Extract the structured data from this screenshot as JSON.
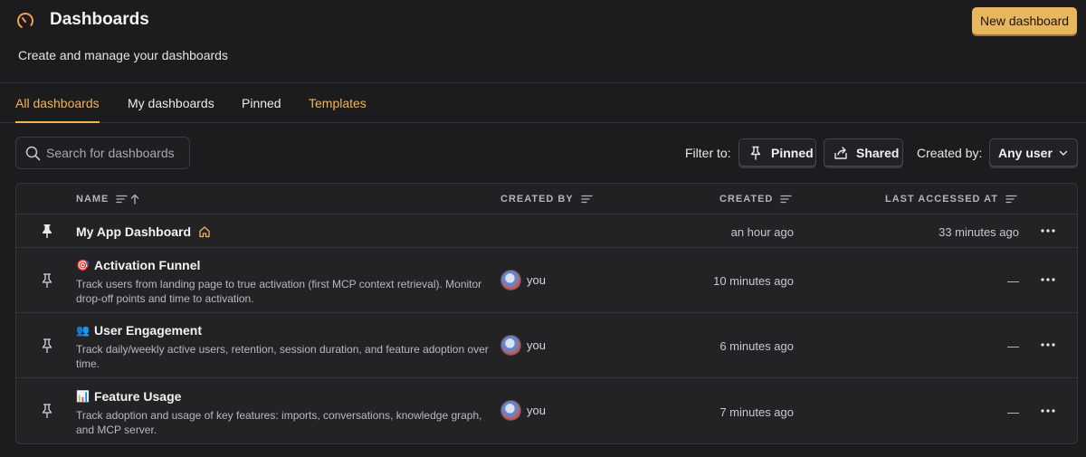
{
  "header": {
    "title": "Dashboards",
    "subtitle": "Create and manage your dashboards",
    "new_button": "New dashboard",
    "accent": "#e9b660"
  },
  "tabs": [
    {
      "label": "All dashboards",
      "active": true
    },
    {
      "label": "My dashboards",
      "active": false
    },
    {
      "label": "Pinned",
      "active": false
    },
    {
      "label": "Templates",
      "active": false
    }
  ],
  "toolbar": {
    "search_placeholder": "Search for dashboards",
    "filter_label": "Filter to:",
    "pinned_label": "Pinned",
    "shared_label": "Shared",
    "created_by_label": "Created by:",
    "created_by_value": "Any user"
  },
  "table": {
    "columns": {
      "name": "NAME",
      "created_by": "CREATED BY",
      "created": "CREATED",
      "last_accessed": "LAST ACCESSED AT"
    },
    "rows": [
      {
        "pinned": true,
        "emoji": "",
        "name": "My App Dashboard",
        "description": "",
        "creator": "",
        "created": "an hour ago",
        "last_accessed": "33 minutes ago",
        "home_icon": "home-icon"
      },
      {
        "pinned": false,
        "emoji": "🎯",
        "name": "Activation Funnel",
        "description": "Track users from landing page to true activation (first MCP context retrieval). Monitor drop-off points and time to activation.",
        "creator": "you",
        "created": "10 minutes ago",
        "last_accessed": "—"
      },
      {
        "pinned": false,
        "emoji": "👥",
        "name": "User Engagement",
        "description": "Track daily/weekly active users, retention, session duration, and feature adoption over time.",
        "creator": "you",
        "created": "6 minutes ago",
        "last_accessed": "—"
      },
      {
        "pinned": false,
        "emoji": "📊",
        "name": "Feature Usage",
        "description": "Track adoption and usage of key features: imports, conversations, knowledge graph, and MCP server.",
        "creator": "you",
        "created": "7 minutes ago",
        "last_accessed": "—"
      }
    ]
  }
}
